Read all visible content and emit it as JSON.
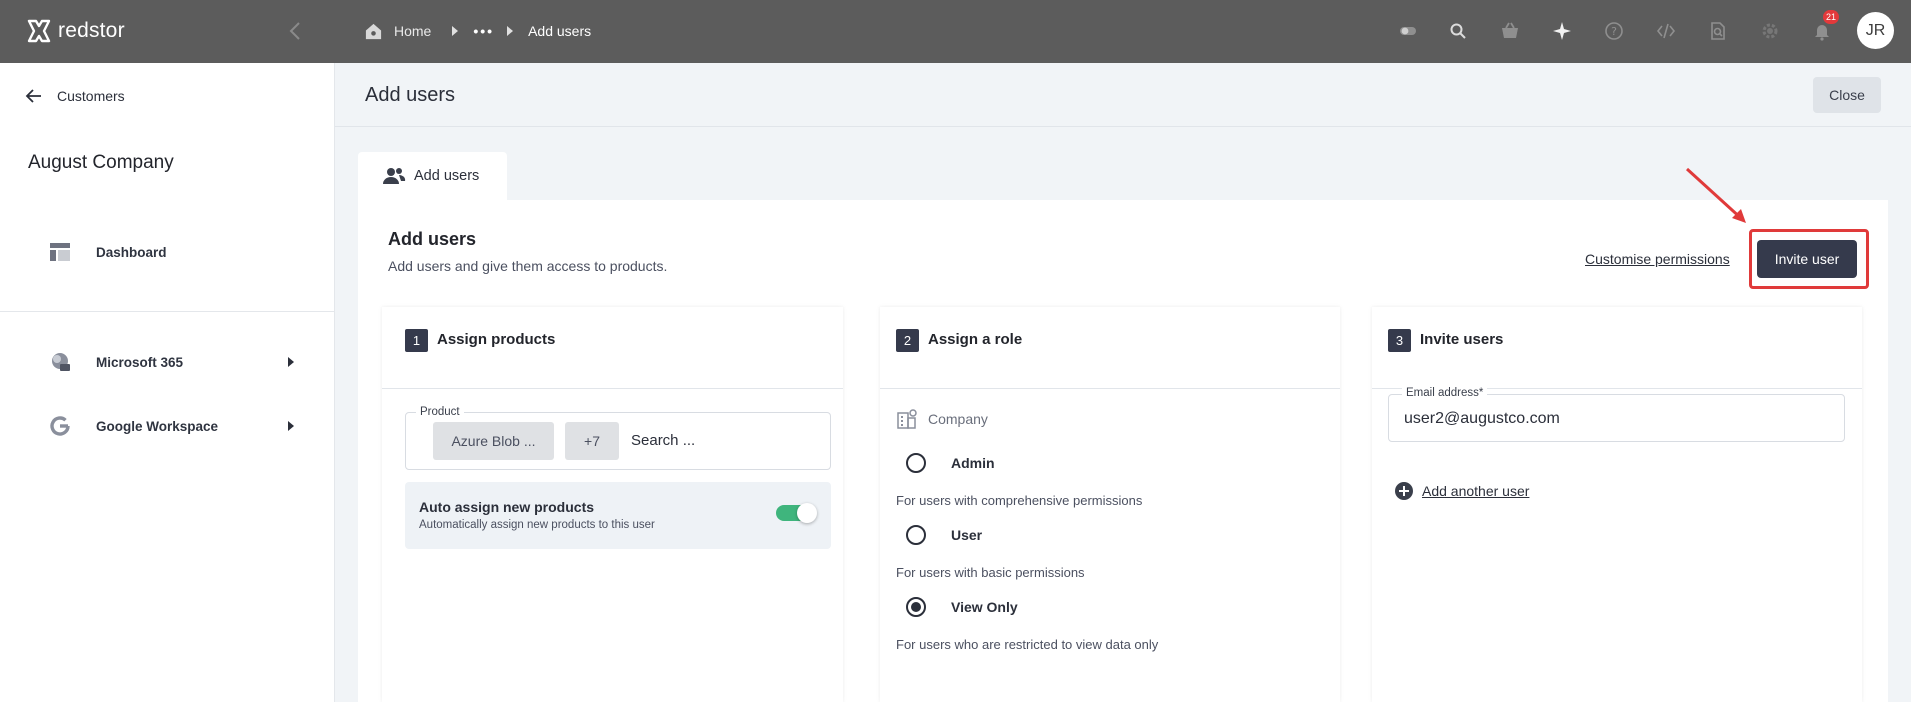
{
  "app": {
    "brand": "redstor",
    "avatar_initials": "JR",
    "notification_count": "21"
  },
  "breadcrumb": {
    "home": "Home",
    "ellipsis": "•••",
    "current": "Add users"
  },
  "sidebar": {
    "back_label": "Customers",
    "company_name": "August Company",
    "items": [
      {
        "label": "Dashboard",
        "icon": "dashboard-icon"
      },
      {
        "label": "Microsoft 365",
        "icon": "microsoft-365-icon"
      },
      {
        "label": "Google Workspace",
        "icon": "google-icon"
      }
    ]
  },
  "page": {
    "title": "Add users",
    "close_label": "Close",
    "tab_label": "Add users"
  },
  "card": {
    "title": "Add users",
    "subtitle": "Add users and give them access to products.",
    "customise_label": "Customise permissions",
    "invite_label": "Invite user"
  },
  "step1": {
    "number": "1",
    "title": "Assign products",
    "product_label": "Product",
    "chips": [
      "Azure Blob ...",
      "+7"
    ],
    "search_placeholder": "Search ...",
    "auto_title": "Auto assign new products",
    "auto_sub": "Automatically assign new products to this user",
    "auto_enabled": true
  },
  "step2": {
    "number": "2",
    "title": "Assign a role",
    "scope": "Company",
    "roles": [
      {
        "label": "Admin",
        "desc": "For users with comprehensive permissions",
        "selected": false
      },
      {
        "label": "User",
        "desc": "For users with basic permissions",
        "selected": false
      },
      {
        "label": "View Only",
        "desc": "For users who are restricted to view data only",
        "selected": true
      }
    ]
  },
  "step3": {
    "number": "3",
    "title": "Invite users",
    "email_label": "Email address*",
    "email_value": "user2@augustco.com",
    "add_another_label": "Add another user"
  },
  "colors": {
    "topbar": "#5c5c5c",
    "primary_button": "#353a4c",
    "highlight": "#e03a3a",
    "toggle_on": "#3fb57d"
  }
}
